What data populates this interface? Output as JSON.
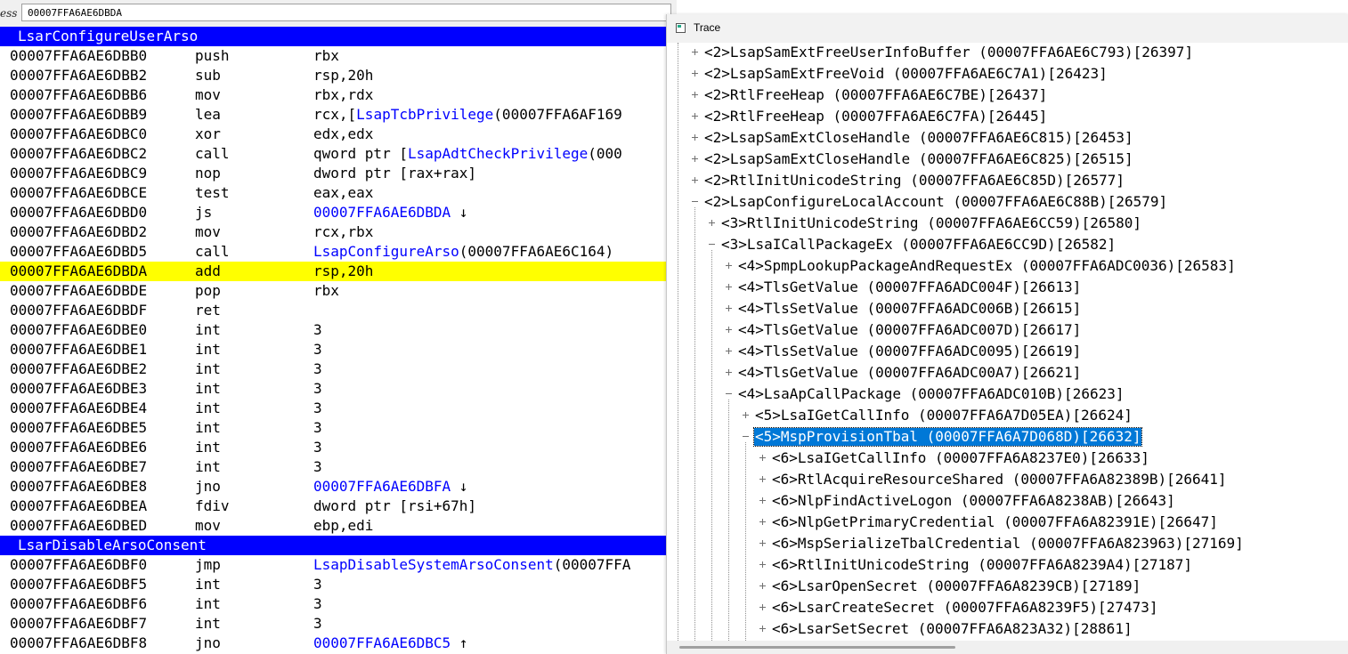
{
  "address_bar": {
    "label": "ess",
    "value": "00007FFA6AE6DBDA"
  },
  "disasm": [
    {
      "type": "header",
      "text": "LsarConfigureUserArso"
    },
    {
      "addr": "00007FFA6AE6DBB0",
      "mn": "push",
      "ops": [
        {
          "t": "rbx"
        }
      ]
    },
    {
      "addr": "00007FFA6AE6DBB2",
      "mn": "sub",
      "ops": [
        {
          "t": "rsp,20h"
        }
      ]
    },
    {
      "addr": "00007FFA6AE6DBB6",
      "mn": "mov",
      "ops": [
        {
          "t": "rbx,rdx"
        }
      ]
    },
    {
      "addr": "00007FFA6AE6DBB9",
      "mn": "lea",
      "ops": [
        {
          "t": "rcx,["
        },
        {
          "t": "LsapTcbPrivilege",
          "s": true
        },
        {
          "t": "(00007FFA6AF169"
        }
      ]
    },
    {
      "addr": "00007FFA6AE6DBC0",
      "mn": "xor",
      "ops": [
        {
          "t": "edx,edx"
        }
      ]
    },
    {
      "addr": "00007FFA6AE6DBC2",
      "mn": "call",
      "ops": [
        {
          "t": "qword ptr ["
        },
        {
          "t": "LsapAdtCheckPrivilege",
          "s": true
        },
        {
          "t": "(000"
        }
      ]
    },
    {
      "addr": "00007FFA6AE6DBC9",
      "mn": "nop",
      "ops": [
        {
          "t": "dword ptr [rax+rax]"
        }
      ]
    },
    {
      "addr": "00007FFA6AE6DBCE",
      "mn": "test",
      "ops": [
        {
          "t": "eax,eax"
        }
      ]
    },
    {
      "addr": "00007FFA6AE6DBD0",
      "mn": "js",
      "ops": [
        {
          "t": "00007FFA6AE6DBDA",
          "s": true
        },
        {
          "t": " ↓"
        }
      ]
    },
    {
      "addr": "00007FFA6AE6DBD2",
      "mn": "mov",
      "ops": [
        {
          "t": "rcx,rbx"
        }
      ]
    },
    {
      "addr": "00007FFA6AE6DBD5",
      "mn": "call",
      "ops": [
        {
          "t": "LsapConfigureArso",
          "s": true
        },
        {
          "t": "(00007FFA6AE6C164)"
        }
      ]
    },
    {
      "addr": "00007FFA6AE6DBDA",
      "mn": "add",
      "ops": [
        {
          "t": "rsp,20h"
        }
      ],
      "hl": true
    },
    {
      "addr": "00007FFA6AE6DBDE",
      "mn": "pop",
      "ops": [
        {
          "t": "rbx"
        }
      ]
    },
    {
      "addr": "00007FFA6AE6DBDF",
      "mn": "ret",
      "ops": []
    },
    {
      "addr": "00007FFA6AE6DBE0",
      "mn": "int",
      "ops": [
        {
          "t": "3"
        }
      ]
    },
    {
      "addr": "00007FFA6AE6DBE1",
      "mn": "int",
      "ops": [
        {
          "t": "3"
        }
      ]
    },
    {
      "addr": "00007FFA6AE6DBE2",
      "mn": "int",
      "ops": [
        {
          "t": "3"
        }
      ]
    },
    {
      "addr": "00007FFA6AE6DBE3",
      "mn": "int",
      "ops": [
        {
          "t": "3"
        }
      ]
    },
    {
      "addr": "00007FFA6AE6DBE4",
      "mn": "int",
      "ops": [
        {
          "t": "3"
        }
      ]
    },
    {
      "addr": "00007FFA6AE6DBE5",
      "mn": "int",
      "ops": [
        {
          "t": "3"
        }
      ]
    },
    {
      "addr": "00007FFA6AE6DBE6",
      "mn": "int",
      "ops": [
        {
          "t": "3"
        }
      ]
    },
    {
      "addr": "00007FFA6AE6DBE7",
      "mn": "int",
      "ops": [
        {
          "t": "3"
        }
      ]
    },
    {
      "addr": "00007FFA6AE6DBE8",
      "mn": "jno",
      "ops": [
        {
          "t": "00007FFA6AE6DBFA",
          "s": true
        },
        {
          "t": " ↓"
        }
      ]
    },
    {
      "addr": "00007FFA6AE6DBEA",
      "mn": "fdiv",
      "ops": [
        {
          "t": "dword ptr [rsi+67h]"
        }
      ]
    },
    {
      "addr": "00007FFA6AE6DBED",
      "mn": "mov",
      "ops": [
        {
          "t": "ebp,edi"
        }
      ]
    },
    {
      "type": "header",
      "text": "LsarDisableArsoConsent"
    },
    {
      "addr": "00007FFA6AE6DBF0",
      "mn": "jmp",
      "ops": [
        {
          "t": "LsapDisableSystemArsoConsent",
          "s": true
        },
        {
          "t": "(00007FFA"
        }
      ]
    },
    {
      "addr": "00007FFA6AE6DBF5",
      "mn": "int",
      "ops": [
        {
          "t": "3"
        }
      ]
    },
    {
      "addr": "00007FFA6AE6DBF6",
      "mn": "int",
      "ops": [
        {
          "t": "3"
        }
      ]
    },
    {
      "addr": "00007FFA6AE6DBF7",
      "mn": "int",
      "ops": [
        {
          "t": "3"
        }
      ]
    },
    {
      "addr": "00007FFA6AE6DBF8",
      "mn": "jno",
      "ops": [
        {
          "t": "00007FFA6AE6DBC5",
          "s": true
        },
        {
          "t": " ↑"
        }
      ]
    }
  ],
  "trace": {
    "title": "Trace",
    "nodes": [
      {
        "level": 0,
        "text": "<2>LsapSamExtFreeUserInfoBuffer (00007FFA6AE6C793)[26397]",
        "exp": "+"
      },
      {
        "level": 0,
        "text": "<2>LsapSamExtFreeVoid (00007FFA6AE6C7A1)[26423]",
        "exp": "+"
      },
      {
        "level": 0,
        "text": "<2>RtlFreeHeap (00007FFA6AE6C7BE)[26437]",
        "exp": "+"
      },
      {
        "level": 0,
        "text": "<2>RtlFreeHeap (00007FFA6AE6C7FA)[26445]",
        "exp": "+"
      },
      {
        "level": 0,
        "text": "<2>LsapSamExtCloseHandle (00007FFA6AE6C815)[26453]",
        "exp": "+"
      },
      {
        "level": 0,
        "text": "<2>LsapSamExtCloseHandle (00007FFA6AE6C825)[26515]",
        "exp": "+"
      },
      {
        "level": 0,
        "text": "<2>RtlInitUnicodeString (00007FFA6AE6C85D)[26577]",
        "exp": "+"
      },
      {
        "level": 0,
        "text": "<2>LsapConfigureLocalAccount (00007FFA6AE6C88B)[26579]",
        "exp": "-"
      },
      {
        "level": 1,
        "text": "<3>RtlInitUnicodeString (00007FFA6AE6CC59)[26580]",
        "exp": "+"
      },
      {
        "level": 1,
        "text": "<3>LsaICallPackageEx (00007FFA6AE6CC9D)[26582]",
        "exp": "-"
      },
      {
        "level": 2,
        "text": "<4>SpmpLookupPackageAndRequestEx (00007FFA6ADC0036)[26583]",
        "exp": "+"
      },
      {
        "level": 2,
        "text": "<4>TlsGetValue (00007FFA6ADC004F)[26613]",
        "exp": "+"
      },
      {
        "level": 2,
        "text": "<4>TlsSetValue (00007FFA6ADC006B)[26615]",
        "exp": "+"
      },
      {
        "level": 2,
        "text": "<4>TlsGetValue (00007FFA6ADC007D)[26617]",
        "exp": "+"
      },
      {
        "level": 2,
        "text": "<4>TlsSetValue (00007FFA6ADC0095)[26619]",
        "exp": "+"
      },
      {
        "level": 2,
        "text": "<4>TlsGetValue (00007FFA6ADC00A7)[26621]",
        "exp": "+"
      },
      {
        "level": 2,
        "text": "<4>LsaApCallPackage (00007FFA6ADC010B)[26623]",
        "exp": "-"
      },
      {
        "level": 3,
        "text": "<5>LsaIGetCallInfo (00007FFA6A7D05EA)[26624]",
        "exp": "+"
      },
      {
        "level": 3,
        "text": "<5>MspProvisionTbal (00007FFA6A7D068D)[26632]",
        "exp": "-",
        "selected": true
      },
      {
        "level": 4,
        "text": "<6>LsaIGetCallInfo (00007FFA6A8237E0)[26633]",
        "exp": "+"
      },
      {
        "level": 4,
        "text": "<6>RtlAcquireResourceShared (00007FFA6A82389B)[26641]",
        "exp": "+"
      },
      {
        "level": 4,
        "text": "<6>NlpFindActiveLogon (00007FFA6A8238AB)[26643]",
        "exp": "+"
      },
      {
        "level": 4,
        "text": "<6>NlpGetPrimaryCredential (00007FFA6A82391E)[26647]",
        "exp": "+"
      },
      {
        "level": 4,
        "text": "<6>MspSerializeTbalCredential (00007FFA6A823963)[27169]",
        "exp": "+"
      },
      {
        "level": 4,
        "text": "<6>RtlInitUnicodeString (00007FFA6A8239A4)[27187]",
        "exp": "+"
      },
      {
        "level": 4,
        "text": "<6>LsarOpenSecret (00007FFA6A8239CB)[27189]",
        "exp": "+"
      },
      {
        "level": 4,
        "text": "<6>LsarCreateSecret (00007FFA6A8239F5)[27473]",
        "exp": "+"
      },
      {
        "level": 4,
        "text": "<6>LsarSetSecret (00007FFA6A823A32)[28861]",
        "exp": "+"
      }
    ]
  },
  "colors": {
    "header_bg": "#0000ff",
    "highlight_bg": "#ffff00",
    "symbol": "#0000ff",
    "selection_bg": "#0078d7"
  },
  "icons": {
    "trace_window": "window-icon",
    "expand": "plus-box-icon",
    "collapse": "minus-box-icon"
  }
}
